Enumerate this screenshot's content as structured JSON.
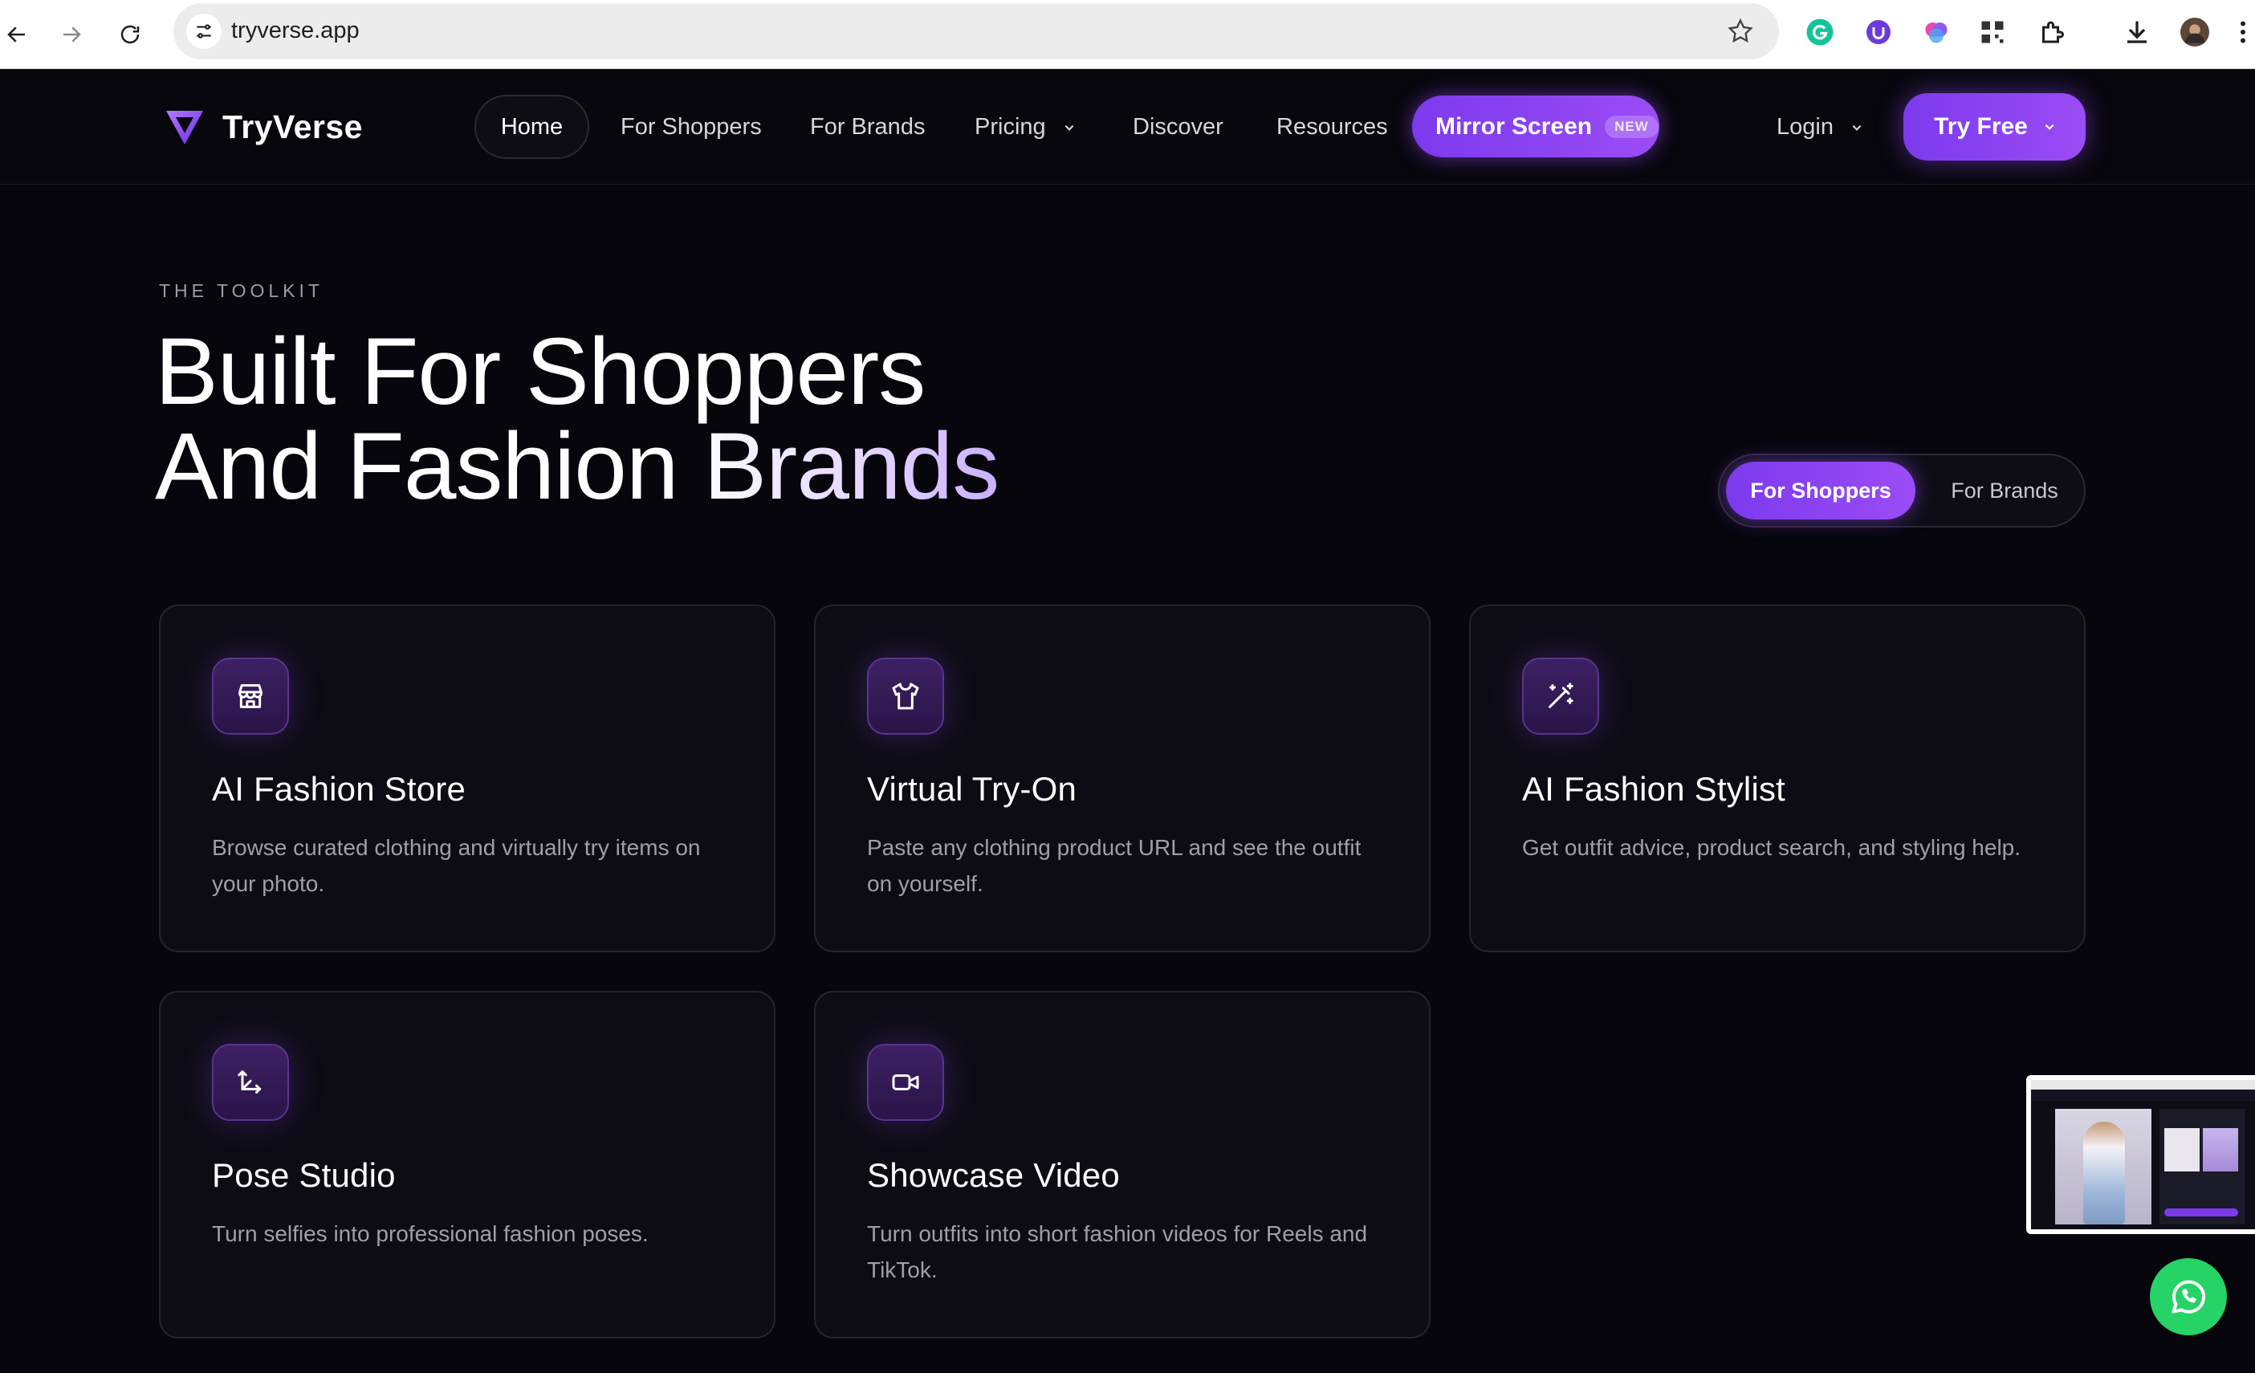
{
  "browser": {
    "url": "tryverse.app"
  },
  "header": {
    "logo_text": "TryVerse",
    "nav": {
      "home": "Home",
      "for_shoppers": "For Shoppers",
      "for_brands": "For Brands",
      "pricing": "Pricing",
      "discover": "Discover",
      "resources": "Resources"
    },
    "mirror_screen": {
      "label": "Mirror Screen",
      "badge": "NEW"
    },
    "login": "Login",
    "try_free": "Try Free"
  },
  "hero": {
    "eyebrow": "THE TOOLKIT",
    "headline_line1": "Built For Shoppers",
    "headline_line2": "And Fashion Brands",
    "toggle": {
      "active": "For Shoppers",
      "inactive": "For Brands"
    }
  },
  "cards": [
    {
      "icon": "store-icon",
      "title": "AI Fashion Store",
      "description": "Browse curated clothing and virtually try items on your photo."
    },
    {
      "icon": "shirt-icon",
      "title": "Virtual Try-On",
      "description": "Paste any clothing product URL and see the outfit on yourself."
    },
    {
      "icon": "magic-wand-icon",
      "title": "AI Fashion Stylist",
      "description": "Get outfit advice, product search, and styling help."
    },
    {
      "icon": "move-arrows-icon",
      "title": "Pose Studio",
      "description": "Turn selfies into professional fashion poses."
    },
    {
      "icon": "video-icon",
      "title": "Showcase Video",
      "description": "Turn outfits into short fashion videos for Reels and TikTok."
    }
  ],
  "colors": {
    "accent": "#7c3aed",
    "accent_light": "#9b4cf5",
    "background": "#07060d",
    "card_bg": "#0d0c15",
    "whatsapp": "#25d366"
  }
}
